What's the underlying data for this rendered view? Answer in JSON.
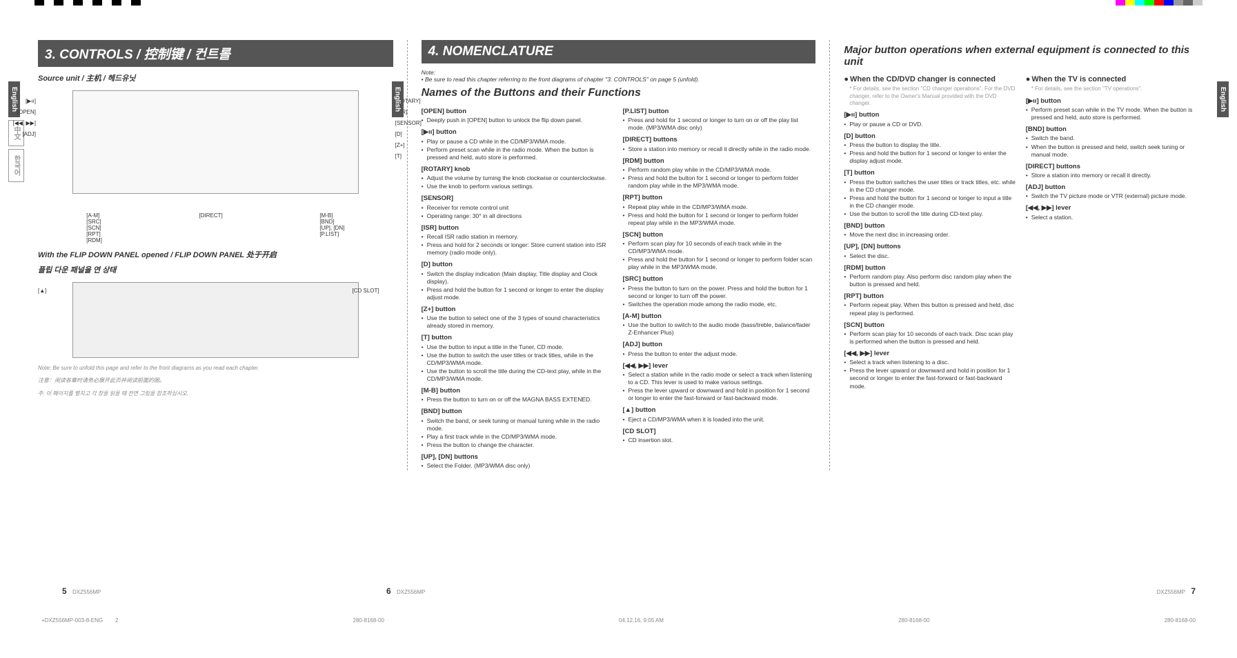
{
  "model": "DXZ556MP",
  "doc_id": "280-8168-00",
  "timestamp": "04.12.16, 9:05 AM",
  "footer_file": "+DXZ556MP-003-8-ENG",
  "footer_page": "2",
  "page_numbers": {
    "p5": "5",
    "p6": "6",
    "p7": "7"
  },
  "lang_tabs": {
    "en": "English",
    "cn": "中文",
    "kr": "한국어"
  },
  "page5": {
    "title": "3. CONTROLS / 控制键 / 컨트롤",
    "source_unit": "Source unit / 主机 / 헤드유닛",
    "flip": "With the FLIP DOWN PANEL opened / FLIP DOWN PANEL 处于开启",
    "flip_kr": "플립 다운 패널을 연 상태",
    "note": "Note: Be sure to unfold this page and refer to the front diagrams as you read each chapter.",
    "note_cn": "注意：阅读各章时请务必展开此页并阅读前面的图。",
    "note_kr": "주: 이 페이지를 펼치고 각 장을 읽을 때 전면 그림을 참조하십시오.",
    "labels_left": [
      "[▶ıı]",
      "[OPEN]",
      "[◀◀, ▶▶]",
      "[ADJ]"
    ],
    "labels_right": [
      "[ROTARY]",
      "[ISR]",
      "[SENSOR]",
      "[D]",
      "[Z+]",
      "[T]"
    ],
    "labels_bottom": [
      "[A-M]",
      "[SRC]",
      "[SCN]",
      "[RPT]",
      "[RDM]",
      "[DIRECT]",
      "[M-B]",
      "[BND]",
      "[UP], [DN]",
      "[P.LIST]"
    ],
    "labels2": {
      "left": "[▲]",
      "right": "[CD SLOT]"
    }
  },
  "page6": {
    "title": "4. NOMENCLATURE",
    "note_head": "Note:",
    "note": "• Be sure to read this chapter referring to the front diagrams of chapter \"3. CONTROLS\" on page 5 (unfold).",
    "subtitle": "Names of the Buttons and their Functions",
    "col1": [
      {
        "h": "[OPEN] button",
        "b": [
          "Deeply push in [OPEN] button to unlock the flip down panel."
        ]
      },
      {
        "h": "[▶ıı] button",
        "b": [
          "Play or pause a CD while in the CD/MP3/WMA mode.",
          "Perform preset scan while in the radio mode. When the button is pressed and held, auto store is performed."
        ]
      },
      {
        "h": "[ROTARY] knob",
        "b": [
          "Adjust the volume by turning the knob clockwise or counterclockwise.",
          "Use the knob to perform various settings."
        ]
      },
      {
        "h": "[SENSOR]",
        "b": [
          "Receiver for remote control unit",
          "Operating range: 30° in all directions"
        ]
      },
      {
        "h": "[ISR] button",
        "b": [
          "Recall ISR radio station in memory.",
          "Press and hold for 2 seconds or longer: Store current station into ISR memory (radio mode only)."
        ]
      },
      {
        "h": "[D] button",
        "b": [
          "Switch the display indication (Main display, Title display and Clock display).",
          "Press and hold the button for 1 second or longer to enter the display adjust mode."
        ]
      },
      {
        "h": "[Z+] button",
        "b": [
          "Use the button to select one of the 3 types of sound characteristics already stored in memory."
        ]
      },
      {
        "h": "[T] button",
        "b": [
          "Use the button to input a title in the Tuner, CD mode.",
          "Use the button to switch the user titles or track titles, while in the CD/MP3/WMA mode.",
          "Use the button to scroll the title during the CD-text play, while in the CD/MP3/WMA mode."
        ]
      },
      {
        "h": "[M-B] button",
        "b": [
          "Press the button to turn on or off the MAGNA BASS EXTENED."
        ]
      },
      {
        "h": "[BND] button",
        "b": [
          "Switch the band, or seek tuning or manual tuning while in the radio mode.",
          "Play a first track while in the CD/MP3/WMA mode.",
          "Press the button to change the character."
        ]
      },
      {
        "h": "[UP], [DN] buttons",
        "b": [
          "Select the Folder. (MP3/WMA disc only)"
        ]
      }
    ],
    "col2": [
      {
        "h": "[P.LIST] button",
        "b": [
          "Press and hold for 1 second or longer to turn on or off the play list mode. (MP3/WMA disc only)"
        ]
      },
      {
        "h": "[DIRECT] buttons",
        "b": [
          "Store a station into memory or recall it directly while in the radio mode."
        ]
      },
      {
        "h": "[RDM] button",
        "b": [
          "Perform random play while in the CD/MP3/WMA mode.",
          "Press and hold the button for 1 second or longer to perform folder random play while in the MP3/WMA mode."
        ]
      },
      {
        "h": "[RPT] button",
        "b": [
          "Repeat play while in the CD/MP3/WMA mode.",
          "Press and hold the button for 1 second or longer to perform folder repeat play while in the MP3/WMA mode."
        ]
      },
      {
        "h": "[SCN] button",
        "b": [
          "Perform scan play for 10 seconds of each track while in the CD/MP3/WMA mode.",
          "Press and hold the button for 1 second or longer to perform folder scan play while in the MP3/WMA mode."
        ]
      },
      {
        "h": "[SRC] button",
        "b": [
          "Press the button to turn on the power. Press and hold the button for 1 second or longer to turn off the power.",
          "Switches the operation mode among the radio mode, etc."
        ]
      },
      {
        "h": "[A-M] button",
        "b": [
          "Use the button to switch to the audio mode (bass/treble, balance/fader Z-Enhancer Plus)"
        ]
      },
      {
        "h": "[ADJ] button",
        "b": [
          "Press the button to enter the adjust mode."
        ]
      },
      {
        "h": "[◀◀, ▶▶] lever",
        "b": [
          "Select a station while in the radio mode or select a track when listening to a CD. This lever is used to make various settings.",
          "Press the lever upward or downward and hold in position for 1 second or longer to enter the fast-forward or fast-backward mode."
        ]
      },
      {
        "h": "[▲] button",
        "b": [
          "Eject a CD/MP3/WMA when it is loaded into the unit."
        ]
      },
      {
        "h": "[CD SLOT]",
        "b": [
          "CD insertion slot."
        ]
      }
    ]
  },
  "page7": {
    "title": "Major button operations when external equipment is connected to this unit",
    "col1": {
      "sec1_h": "When the CD/DVD changer is connected",
      "sec1_note": "* For details, see the section \"CD changer operations\". For the DVD changer, refer to the Owner's Manual provided with the DVD changer.",
      "items": [
        {
          "h": "[▶ıı] button",
          "b": [
            "Play or pause a CD or DVD."
          ]
        },
        {
          "h": "[D] button",
          "b": [
            "Press the button to display the title.",
            "Press and hold the button for 1 second or longer to enter the display adjust mode."
          ]
        },
        {
          "h": "[T] button",
          "b": [
            "Press the button switches the user titles or track titles, etc. while in the CD changer mode.",
            "Press and hold the button for 1 second or longer to input a title in the CD changer mode.",
            "Use the button to scroll the title during CD-text play."
          ]
        },
        {
          "h": "[BND] button",
          "b": [
            "Move the next disc in increasing order."
          ]
        },
        {
          "h": "[UP], [DN] buttons",
          "b": [
            "Select the disc."
          ]
        },
        {
          "h": "[RDM] button",
          "b": [
            "Perform random play. Also perform disc random play when the button is pressed and held."
          ]
        },
        {
          "h": "[RPT] button",
          "b": [
            "Perform repeat play. When this button is pressed and held, disc repeat play is performed."
          ]
        },
        {
          "h": "[SCN] button",
          "b": [
            "Perform scan play for 10 seconds of each track. Disc scan play is performed when the button is pressed and held."
          ]
        },
        {
          "h": "[◀◀, ▶▶] lever",
          "b": [
            "Select a track when listening to a disc.",
            "Press the lever upward or downward and hold in position for 1 second or longer to enter the fast-forward or fast-backward mode."
          ]
        }
      ]
    },
    "col2": {
      "sec2_h": "When the TV is connected",
      "sec2_note": "* For details, see the section \"TV operations\".",
      "items": [
        {
          "h": "[▶ıı] button",
          "b": [
            "Perform preset scan while in the TV mode. When the button is pressed and held, auto store is performed."
          ]
        },
        {
          "h": "[BND] button",
          "b": [
            "Switch the band.",
            "When the button is pressed and held, switch seek tuning or manual mode."
          ]
        },
        {
          "h": "[DIRECT] buttons",
          "b": [
            "Store a station into memory or recall it directly."
          ]
        },
        {
          "h": "[ADJ] button",
          "b": [
            "Switch the TV picture mode or VTR (external) picture mode."
          ]
        },
        {
          "h": "[◀◀, ▶▶] lever",
          "b": [
            "Select a station."
          ]
        }
      ]
    }
  }
}
